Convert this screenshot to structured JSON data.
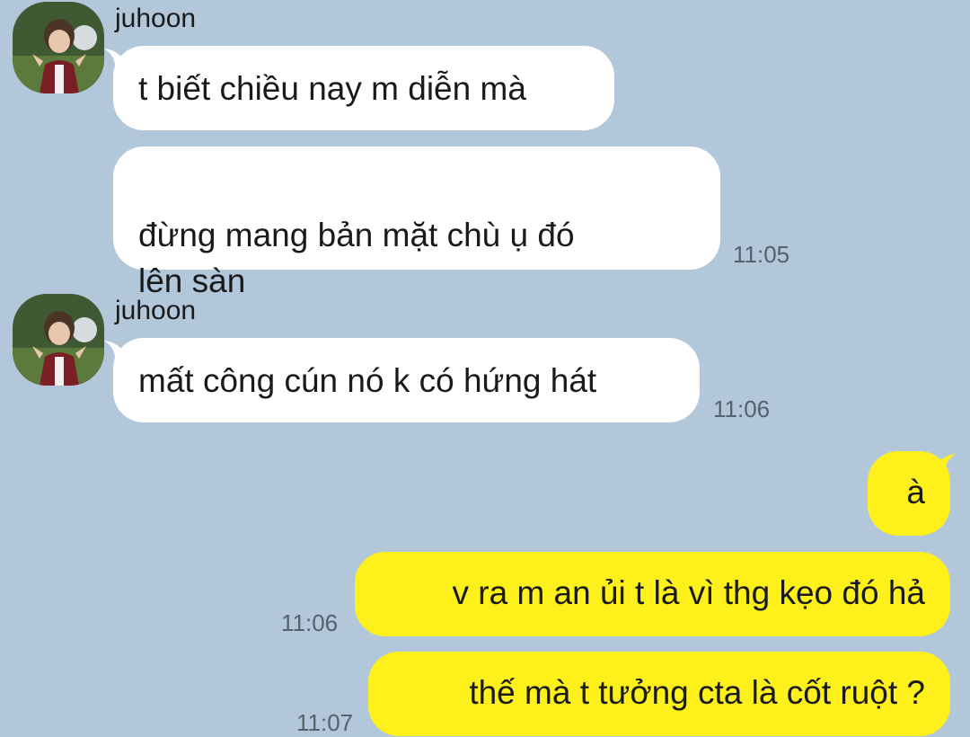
{
  "conversation": {
    "groups": [
      {
        "sender": "juhoon",
        "messages": [
          {
            "text": "t biết chiều nay m diễn mà"
          },
          {
            "text": "đừng mang bản mặt chù ụ đó\nlên sàn",
            "time": "11:05"
          }
        ]
      },
      {
        "sender": "juhoon",
        "messages": [
          {
            "text": "mất công cún nó k có hứng hát",
            "time": "11:06"
          }
        ]
      }
    ],
    "outgoing": [
      {
        "text": "à"
      },
      {
        "text": "v ra m an ủi t là vì thg kẹo đó hả",
        "time": "11:06"
      },
      {
        "text": "thế mà t tưởng cta là cốt ruột ?",
        "time": "11:07"
      }
    ]
  },
  "colors": {
    "background": "#b2c7da",
    "incoming_bubble": "#ffffff",
    "outgoing_bubble": "#fef01b",
    "timestamp": "#56616c"
  },
  "icons": {
    "avatar": "profile-photo"
  }
}
